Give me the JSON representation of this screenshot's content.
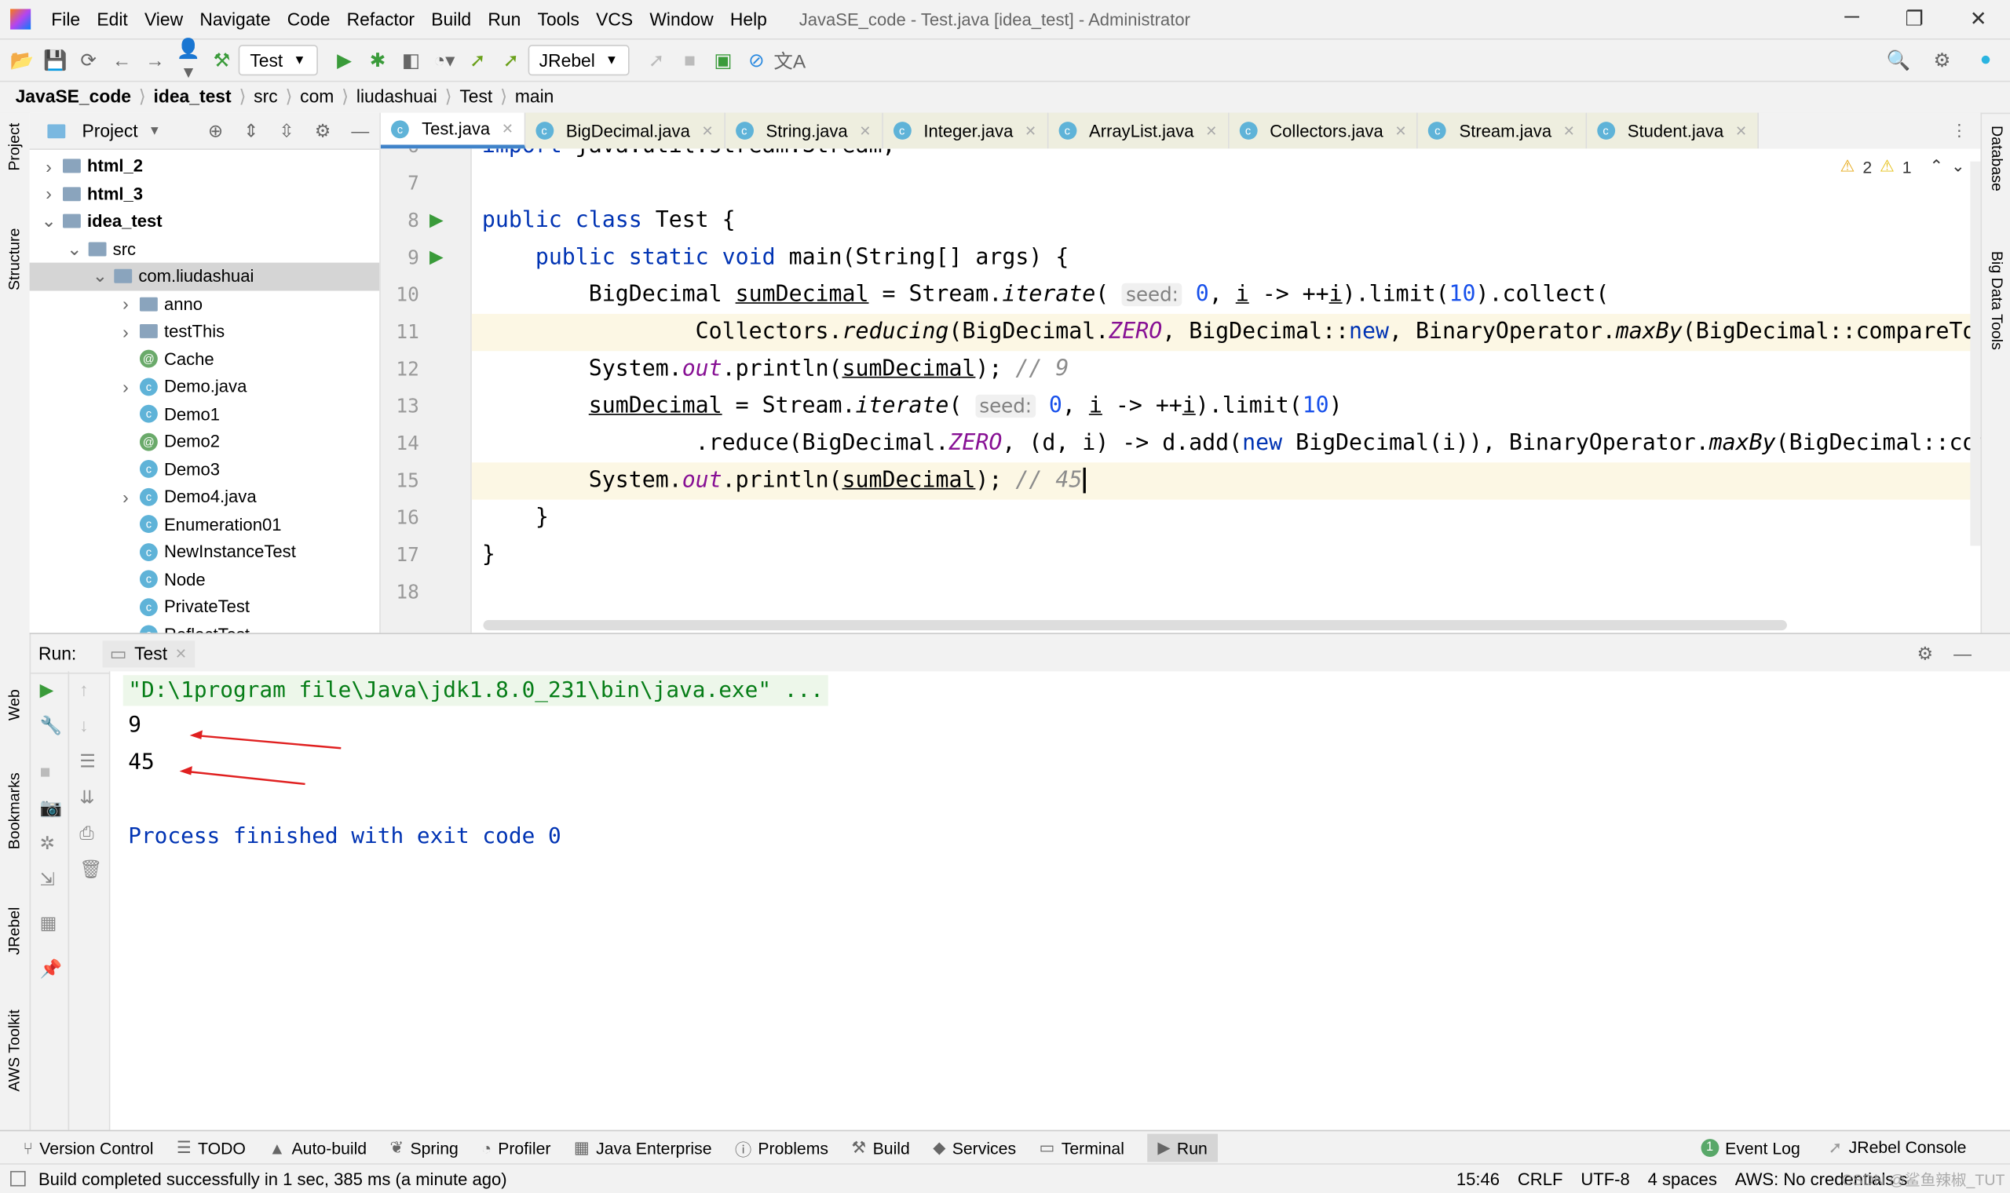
{
  "window": {
    "title": "JavaSE_code - Test.java [idea_test] - Administrator"
  },
  "menu": [
    "File",
    "Edit",
    "View",
    "Navigate",
    "Code",
    "Refactor",
    "Build",
    "Run",
    "Tools",
    "VCS",
    "Window",
    "Help"
  ],
  "toolbar": {
    "run_config": "Test",
    "jrebel_config": "JRebel"
  },
  "breadcrumb": [
    "JavaSE_code",
    "idea_test",
    "src",
    "com",
    "liudashuai",
    "Test",
    "main"
  ],
  "left_strip": [
    "Project",
    "Structure",
    "Web",
    "Bookmarks",
    "JRebel",
    "AWS Toolkit"
  ],
  "right_strip": [
    "Database",
    "Big Data Tools"
  ],
  "project": {
    "title": "Project",
    "tree": [
      {
        "label": "html_2",
        "depth": 1,
        "arrow": "right",
        "icon": "folder",
        "bold": true
      },
      {
        "label": "html_3",
        "depth": 1,
        "arrow": "right",
        "icon": "folder",
        "bold": true
      },
      {
        "label": "idea_test",
        "depth": 1,
        "arrow": "down",
        "icon": "folder",
        "bold": true
      },
      {
        "label": "src",
        "depth": 2,
        "arrow": "down",
        "icon": "folder"
      },
      {
        "label": "com.liudashuai",
        "depth": 3,
        "arrow": "down",
        "icon": "folder",
        "selected": true
      },
      {
        "label": "anno",
        "depth": 4,
        "arrow": "right",
        "icon": "folder"
      },
      {
        "label": "testThis",
        "depth": 4,
        "arrow": "right",
        "icon": "folder"
      },
      {
        "label": "Cache",
        "depth": 4,
        "icon": "annotation"
      },
      {
        "label": "Demo.java",
        "depth": 4,
        "arrow": "right",
        "icon": "class"
      },
      {
        "label": "Demo1",
        "depth": 4,
        "icon": "class"
      },
      {
        "label": "Demo2",
        "depth": 4,
        "icon": "annotation"
      },
      {
        "label": "Demo3",
        "depth": 4,
        "icon": "class"
      },
      {
        "label": "Demo4.java",
        "depth": 4,
        "arrow": "right",
        "icon": "class"
      },
      {
        "label": "Enumeration01",
        "depth": 4,
        "icon": "class"
      },
      {
        "label": "NewInstanceTest",
        "depth": 4,
        "icon": "class"
      },
      {
        "label": "Node",
        "depth": 4,
        "icon": "class"
      },
      {
        "label": "PrivateTest",
        "depth": 4,
        "icon": "class"
      },
      {
        "label": "ReflectTest",
        "depth": 4,
        "icon": "class"
      }
    ]
  },
  "tabs": [
    {
      "label": "Test.java",
      "active": true
    },
    {
      "label": "BigDecimal.java"
    },
    {
      "label": "String.java"
    },
    {
      "label": "Integer.java"
    },
    {
      "label": "ArrayList.java"
    },
    {
      "label": "Collectors.java"
    },
    {
      "label": "Stream.java"
    },
    {
      "label": "Student.java"
    }
  ],
  "inspections": {
    "warnings": "2",
    "weak_warnings": "1"
  },
  "code": [
    {
      "n": "6",
      "tokens": [
        [
          "kw",
          "import "
        ],
        [
          "",
          "java.util.stream.Stream;"
        ]
      ]
    },
    {
      "n": "7",
      "tokens": []
    },
    {
      "n": "8",
      "run": true,
      "tokens": [
        [
          "kw",
          "public class "
        ],
        [
          "",
          "Test {"
        ]
      ]
    },
    {
      "n": "9",
      "run": true,
      "tokens": [
        [
          "",
          "    "
        ],
        [
          "kw",
          "public static void "
        ],
        [
          "",
          "main(String[] args) {"
        ]
      ]
    },
    {
      "n": "10",
      "tokens": [
        [
          "",
          "        BigDecimal "
        ],
        [
          "und",
          "sumDecimal"
        ],
        [
          "",
          " = Stream."
        ],
        [
          "it",
          "iterate"
        ],
        [
          "",
          "( "
        ],
        [
          "hint",
          "seed:"
        ],
        [
          "num",
          " 0"
        ],
        [
          "",
          ", "
        ],
        [
          "und",
          "i"
        ],
        [
          "",
          " -> ++"
        ],
        [
          "und",
          "i"
        ],
        [
          "",
          ").limit("
        ],
        [
          "num",
          "10"
        ],
        [
          "",
          ").collect("
        ]
      ]
    },
    {
      "n": "11",
      "highlight": true,
      "tokens": [
        [
          "",
          "                Collectors."
        ],
        [
          "it",
          "reducing"
        ],
        [
          "",
          "(BigDecimal."
        ],
        [
          "st",
          "ZERO"
        ],
        [
          "",
          ", BigDecimal::"
        ],
        [
          "kw",
          "new"
        ],
        [
          "",
          ", BinaryOperator."
        ],
        [
          "it",
          "maxBy"
        ],
        [
          "",
          "(BigDecimal::compareTo"
        ]
      ]
    },
    {
      "n": "12",
      "tokens": [
        [
          "",
          "        System."
        ],
        [
          "st",
          "out"
        ],
        [
          "",
          ".println("
        ],
        [
          "und",
          "sumDecimal"
        ],
        [
          "",
          "); "
        ],
        [
          "cm",
          "// 9"
        ]
      ]
    },
    {
      "n": "13",
      "tokens": [
        [
          "",
          "        "
        ],
        [
          "und",
          "sumDecimal"
        ],
        [
          "",
          " = Stream."
        ],
        [
          "it",
          "iterate"
        ],
        [
          "",
          "( "
        ],
        [
          "hint",
          "seed:"
        ],
        [
          "num",
          " 0"
        ],
        [
          "",
          ", "
        ],
        [
          "und",
          "i"
        ],
        [
          "",
          " -> ++"
        ],
        [
          "und",
          "i"
        ],
        [
          "",
          ").limit("
        ],
        [
          "num",
          "10"
        ],
        [
          "",
          ")"
        ]
      ]
    },
    {
      "n": "14",
      "tokens": [
        [
          "",
          "                .reduce(BigDecimal."
        ],
        [
          "st",
          "ZERO"
        ],
        [
          "",
          ", (d, i) -> d.add("
        ],
        [
          "kw",
          "new "
        ],
        [
          "",
          "BigDecimal(i)), BinaryOperator."
        ],
        [
          "it",
          "maxBy"
        ],
        [
          "",
          "(BigDecimal::compareTo"
        ]
      ]
    },
    {
      "n": "15",
      "highlight": true,
      "tokens": [
        [
          "",
          "        System."
        ],
        [
          "st",
          "out"
        ],
        [
          "",
          ".println("
        ],
        [
          "und",
          "sumDecimal"
        ],
        [
          "",
          "); "
        ],
        [
          "cm",
          "// 45"
        ]
      ]
    },
    {
      "n": "16",
      "tokens": [
        [
          "",
          "    }"
        ]
      ]
    },
    {
      "n": "17",
      "tokens": [
        [
          "",
          "}"
        ]
      ]
    },
    {
      "n": "18",
      "tokens": []
    }
  ],
  "run": {
    "label": "Run:",
    "tab": "Test",
    "output": [
      {
        "text": "\"D:\\1program file\\Java\\jdk1.8.0_231\\bin\\java.exe\" ...",
        "color": "#067d17",
        "bg": "#edf7ea"
      },
      {
        "text": "9",
        "color": "#000000"
      },
      {
        "text": "45",
        "color": "#000000"
      },
      {
        "text": "",
        "color": "#000000"
      },
      {
        "text": "Process finished with exit code 0",
        "color": "#0033b3"
      }
    ]
  },
  "bottom_tools": [
    "Version Control",
    "TODO",
    "Auto-build",
    "Spring",
    "Profiler",
    "Java Enterprise",
    "Problems",
    "Build",
    "Services",
    "Terminal",
    "Run"
  ],
  "bottom_right": {
    "event_log": "Event Log",
    "event_count": "1",
    "jrebel": "JRebel Console"
  },
  "status": {
    "message": "Build completed successfully in 1 sec, 385 ms (a minute ago)",
    "position": "15:46",
    "line_sep": "CRLF",
    "encoding": "UTF-8",
    "indent": "4 spaces",
    "aws": "AWS: No credentials s"
  },
  "watermark": "CSDN @鲨鱼辣椒_TUT"
}
